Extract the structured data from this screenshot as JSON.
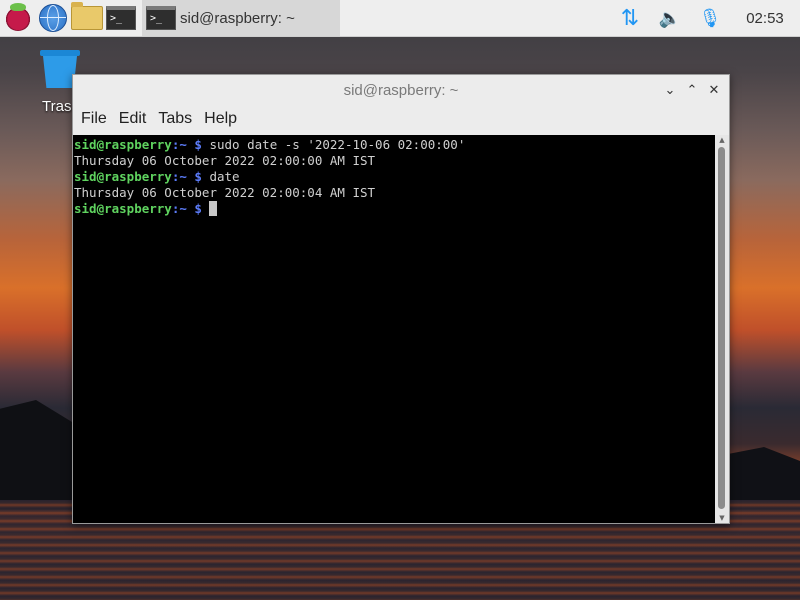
{
  "panel": {
    "launcher_icon": "raspberry-pi-menu",
    "pinned": [
      {
        "name": "browser",
        "icon": "globe-icon"
      },
      {
        "name": "file-manager",
        "icon": "folder-icon"
      },
      {
        "name": "terminal",
        "icon": "terminal-icon",
        "glyph": ">_"
      }
    ],
    "task": {
      "label": "sid@raspberry: ~",
      "icon": "terminal-icon",
      "glyph": ">_"
    },
    "tray": [
      {
        "name": "network",
        "icon": "network-arrows-icon",
        "glyph": "⇅"
      },
      {
        "name": "volume",
        "icon": "speaker-icon",
        "glyph": "🔈"
      },
      {
        "name": "microphone",
        "icon": "microphone-icon",
        "glyph": "🎙"
      }
    ],
    "clock": "02:53"
  },
  "desktop": {
    "trash_label": "Tras"
  },
  "window": {
    "title": "sid@raspberry: ~",
    "controls": {
      "minimize": "⌄",
      "maximize": "⌃",
      "close": "✕"
    },
    "menu": [
      "File",
      "Edit",
      "Tabs",
      "Help"
    ],
    "terminal_lines": [
      {
        "type": "prompt",
        "user": "sid@raspberry",
        "path": ":~",
        "symbol": " $ ",
        "command": "sudo date -s '2022-10-06 02:00:00'"
      },
      {
        "type": "output",
        "text": "Thursday 06 October 2022 02:00:00 AM IST"
      },
      {
        "type": "prompt",
        "user": "sid@raspberry",
        "path": ":~",
        "symbol": " $ ",
        "command": "date"
      },
      {
        "type": "output",
        "text": "Thursday 06 October 2022 02:00:04 AM IST"
      },
      {
        "type": "prompt",
        "user": "sid@raspberry",
        "path": ":~",
        "symbol": " $ ",
        "command": ""
      }
    ]
  },
  "colors": {
    "prompt_user": "#5fd35f",
    "prompt_path": "#5c7cfa",
    "terminal_bg": "#000000",
    "terminal_fg": "#d0d0d0",
    "tray_icons": "#2196f3"
  }
}
